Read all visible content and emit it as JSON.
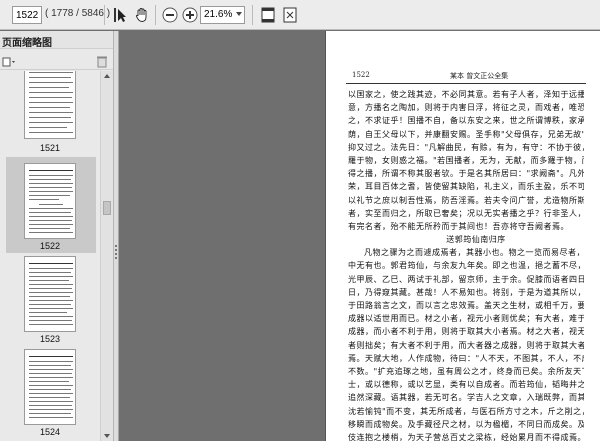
{
  "toolbar": {
    "page_input": "1522",
    "page_count": "( 1778 / 5846 )",
    "zoom": "21.6%",
    "tools": [
      "select-tool-icon",
      "hand-tool-icon",
      "zoom-out-icon",
      "zoom-in-icon",
      "fit-page-icon",
      "fit-width-icon"
    ]
  },
  "sidepanel": {
    "title": "页面缩略图",
    "thumbs": [
      {
        "label": "1521",
        "selected": false
      },
      {
        "label": "1522",
        "selected": true
      },
      {
        "label": "1523",
        "selected": false
      },
      {
        "label": "1524",
        "selected": false
      }
    ]
  },
  "document": {
    "page_number": "1522",
    "running_title": "某本  曾文正公全集",
    "lines": [
      {
        "text": "以国家之，使之践其迹，不必同其意。若有子人者，泽知于远播之",
        "cls": ""
      },
      {
        "text": "意，方播名之陶加，则将于内害日浮，将征之灵，而戏者，唯恐惊",
        "cls": ""
      },
      {
        "text": "之，不求证乎！国播不自，备以东安之来，世之所谓博秩，家承余",
        "cls": ""
      },
      {
        "text": "荫，自王父母以下，并康翻安赐。圣手称\"父母俱存，兄弟无故\"",
        "cls": ""
      },
      {
        "text": "抑又过之。法先日：\"凡解曲民，有赊，有为，有守：不协于彼，不",
        "cls": ""
      },
      {
        "text": "羅于物，女则惑之福。\"若国播者，无为，无献，而多羅于物，而或",
        "cls": ""
      },
      {
        "text": "得之播，所谓不称其服者欤。于是名其所居曰：\"求阙斋\"。凡外至之",
        "cls": ""
      },
      {
        "text": "荣，耳目百体之耆，皆使留其缺陷，礼主义，而乐主盈，乐不可极，",
        "cls": ""
      },
      {
        "text": "以礼节之庶以制吾性焉，防吾淫焉。若夫令问广誉，尤造物所斯予",
        "cls": ""
      },
      {
        "text": "者，实至而归之，所取已奢矣；况以无实者播之乎？行非圣人，而",
        "cls": ""
      },
      {
        "text": "有完名者，殆不能无所矜而于其间也！吾亦将守吾阙者焉。",
        "cls": ""
      },
      {
        "text": "送郭筠仙南归序",
        "cls": "heading"
      },
      {
        "text": "凡物之骤为之而遽成焉者，其器小也。物之一览而易尽者，其",
        "cls": "indent"
      },
      {
        "text": "中无有也。郭君筠仙，与余友九年矣。即之也温，挹之蓄不尽，通",
        "cls": ""
      },
      {
        "text": "光甲辰、乙巳、两试于礼部，留京师，主于余。促膝而语者四日余",
        "cls": ""
      },
      {
        "text": "日，乃得窥其藏。甚哉！人不易知也。将别，于是为道其所以，期",
        "cls": ""
      },
      {
        "text": "于田路翁言之文，而以言之忠效焉。盖天之生材，或相千万，要于",
        "cls": ""
      },
      {
        "text": "成器以适世用而已。材之小者，视元小者则优矣；有大者，难于",
        "cls": ""
      },
      {
        "text": "成器，而小者不利于用，则将于取其大小者焉。材之大者，视无大",
        "cls": ""
      },
      {
        "text": "者则拙矣；有大者不利于用，而大者器之成器，则将于取其大者",
        "cls": ""
      },
      {
        "text": "焉。天赋大地，人作成物，待曰：\"人不天，不图其，不人，不成，",
        "cls": ""
      },
      {
        "text": "不数。\"扩充追琢之地，虽有周公之才，终身而已矣。余所友天下贤",
        "cls": ""
      },
      {
        "text": "士，或以德称，或以艺显，类有以自成者。而若筠仙，韬晦井之姿，",
        "cls": ""
      },
      {
        "text": "追然深藏。语其器，若无可名。学吉人之文章，入瑞既弊，而其外",
        "cls": ""
      },
      {
        "text": "沈若愉钝\"而不变，其无所成者，与医石所方寸之木，斤之削之，不",
        "cls": ""
      },
      {
        "text": "移瞬而成物矣。及手藏径尺之材，以为楹楣，不同日而成矣。及至",
        "cls": ""
      },
      {
        "text": "伎连抱之楼梢，为天子营总百丈之梁栋，经始累月而不得成焉。其",
        "cls": ""
      }
    ]
  }
}
